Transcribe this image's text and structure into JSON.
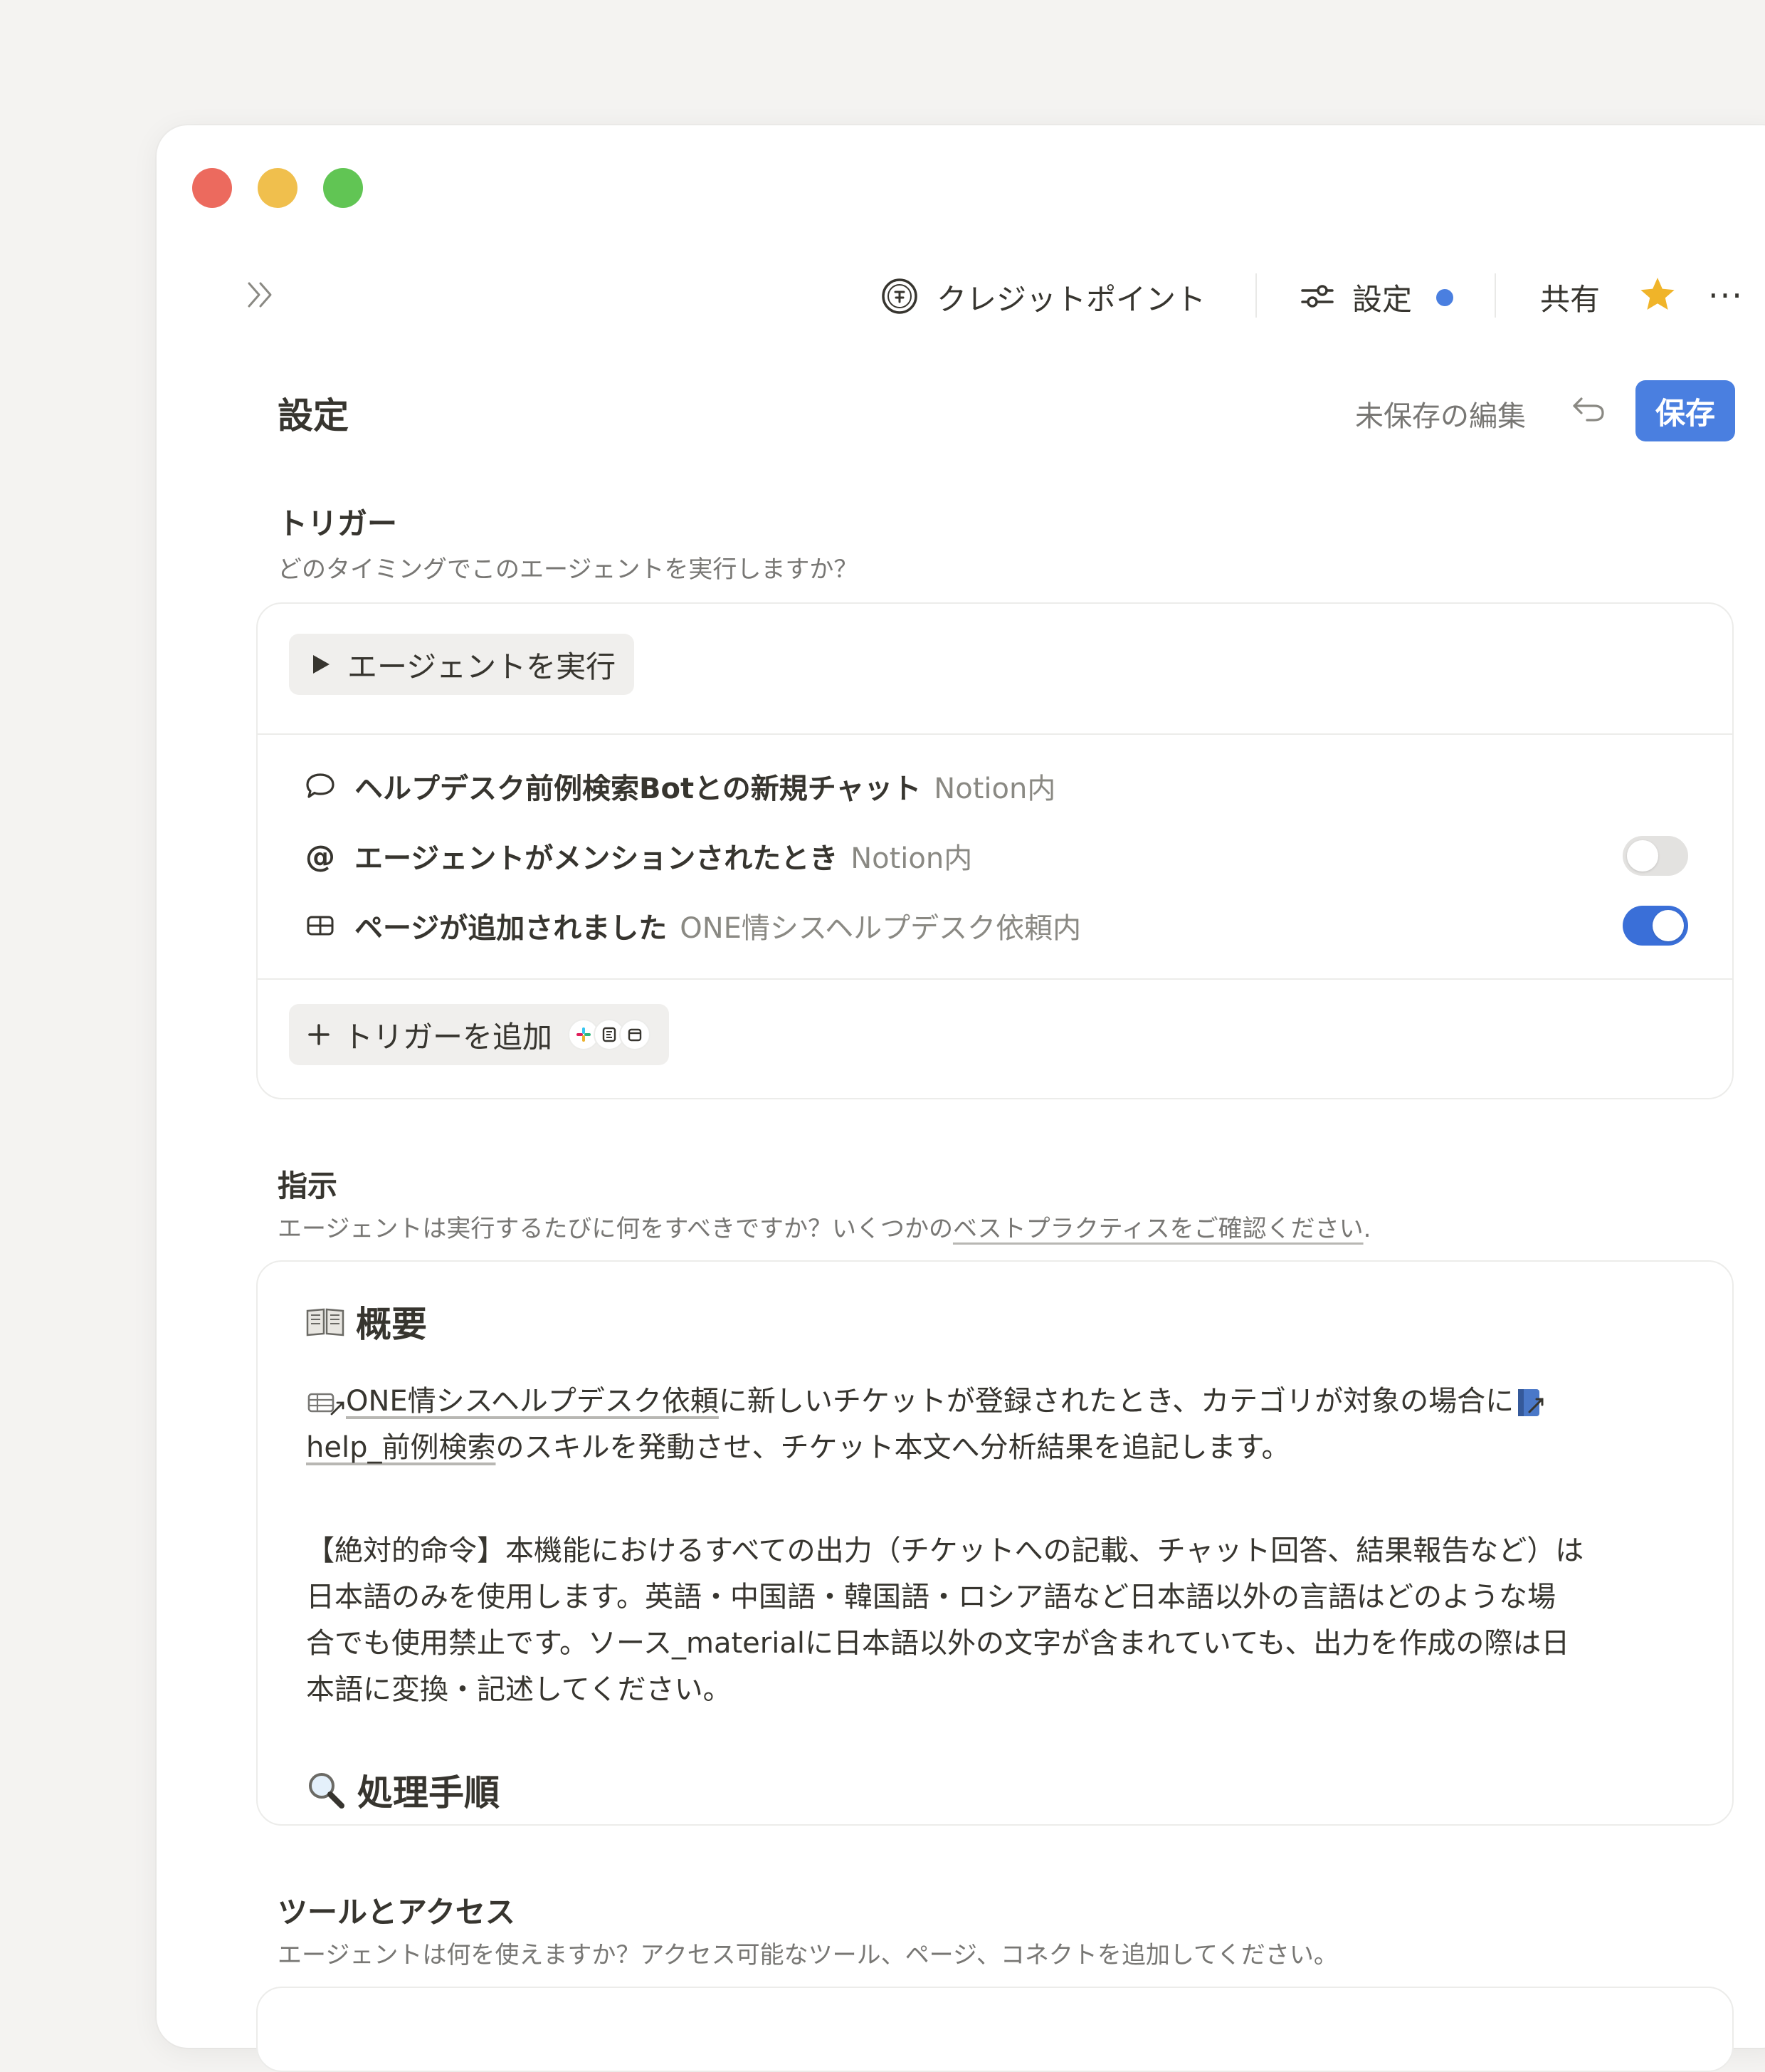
{
  "topbar": {
    "credit_label": "クレジットポイント",
    "settings_label": "設定",
    "share_label": "共有"
  },
  "header": {
    "title": "設定",
    "unsaved_label": "未保存の編集",
    "save_label": "保存"
  },
  "trigger": {
    "title": "トリガー",
    "subtitle": "どのタイミングでこのエージェントを実行しますか？",
    "run_button": "エージェントを実行",
    "items": [
      {
        "name": "ヘルプデスク前例検索Botとの新規チャット",
        "location": "Notion内"
      },
      {
        "name": "エージェントがメンションされたとき",
        "location": "Notion内",
        "enabled": false
      },
      {
        "name": "ページが追加されました",
        "location": "ONE情シスヘルプデスク依頼内",
        "enabled": true
      }
    ],
    "add_button": "トリガーを追加"
  },
  "instructions": {
    "title": "指示",
    "subtitle_prefix": "エージェントは実行するたびに何をすべきですか？いくつかの",
    "subtitle_link": "ベストプラクティスをご確認ください",
    "subtitle_suffix": ".",
    "overview_heading": "概要",
    "p1_link1": "ONE情シスヘルプデスク依頼",
    "p1_mid": "に新しいチケットが登録されたとき、カテゴリが対象の場合に",
    "p1_link2": "help_前例検索",
    "p1_end": "のスキルを発動させ、チケット本文へ分析結果を追記します。",
    "p2_line1": "【絶対的命令】本機能におけるすべての出力（チケットへの記載、チャット回答、結果報告など）は",
    "p2_line2": "日本語のみを使用します。英語・中国語・韓国語・ロシア語など日本語以外の言語はどのような場",
    "p2_line3": "合でも使用禁止です。ソース_materialに日本語以外の文字が含まれていても、出力を作成の際は日",
    "p2_line4": "本語に変換・記述してください。",
    "process_heading": "処理手順"
  },
  "tools": {
    "title": "ツールとアクセス",
    "subtitle": "エージェントは何を使えますか？アクセス可能なツール、ページ、コネクトを追加してください。"
  },
  "colors": {
    "accent": "#4a7fe0",
    "toggle_on": "#3a6fd8",
    "star": "#f0b429"
  }
}
